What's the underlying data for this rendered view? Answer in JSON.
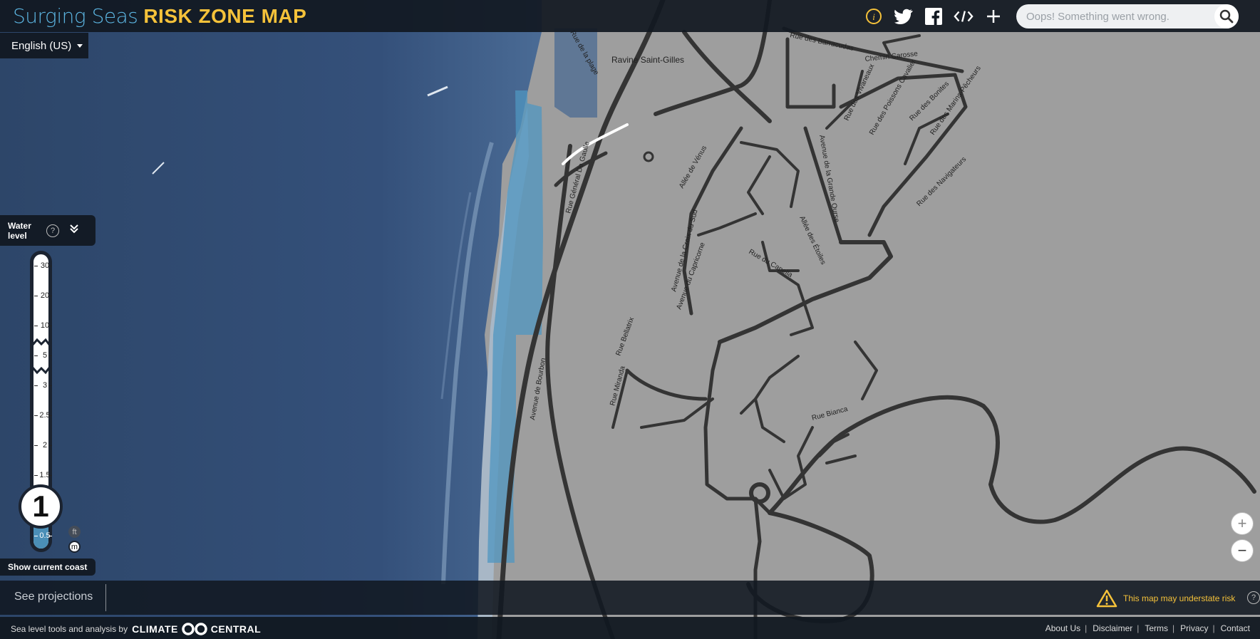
{
  "app": {
    "title_part1": "Surging Seas",
    "title_part2": "RISK ZONE MAP"
  },
  "toolbar": {
    "icons": [
      "info-icon",
      "twitter-icon",
      "facebook-icon",
      "embed-code-icon",
      "plus-icon"
    ]
  },
  "search": {
    "placeholder": "Oops! Something went wrong.",
    "icon": "search-icon"
  },
  "language": {
    "selected": "English (US)"
  },
  "water_level": {
    "title": "Water level",
    "help": "?",
    "ticks": [
      "30",
      "20",
      "10",
      "5",
      "3",
      "2.5",
      "2",
      "1.5",
      "0.5"
    ],
    "current_value": "1",
    "units": [
      "ft",
      "m"
    ],
    "selected_unit": "m"
  },
  "controls": {
    "show_coast": "Show current coast",
    "see_projections": "See projections",
    "warning": "This map may understate risk",
    "warning_help": "?"
  },
  "map": {
    "street_labels": [
      "Rue de la plage",
      "Ravine Saint-Gilles",
      "Rue des Barracudas",
      "Chemin Carosse",
      "Rue des Vivaneaux",
      "Rue des Poissons Cavalier",
      "Rue des Bonites",
      "Rue des Marins-Pêcheurs",
      "Rue des Navigateurs",
      "Avenue de la Grande Ourse",
      "Rue Général De Gaulle",
      "Allée de Vénus",
      "Allée des Étoiles",
      "Avenue de la Croix du Sud",
      "Avenue du Capricorne",
      "Rue du Capella",
      "Rue Bellatrix",
      "Rue Bianca",
      "Avenue de Bourbon",
      "Rue Miranda"
    ],
    "zoom_in": "+",
    "zoom_out": "−"
  },
  "footer": {
    "credit": "Sea level tools and analysis by",
    "brand_left": "CLIMATE",
    "brand_right": "CENTRAL",
    "links": [
      "About Us",
      "Disclaimer",
      "Terms",
      "Privacy",
      "Contact"
    ]
  },
  "colors": {
    "brand_blue": "#5bb4e0",
    "brand_yellow": "#f5c23a",
    "panel": "#111821",
    "land": "#9e9e9e",
    "road": "#333333",
    "water": "#2f4a6e",
    "flood": "#4b8fb7"
  }
}
